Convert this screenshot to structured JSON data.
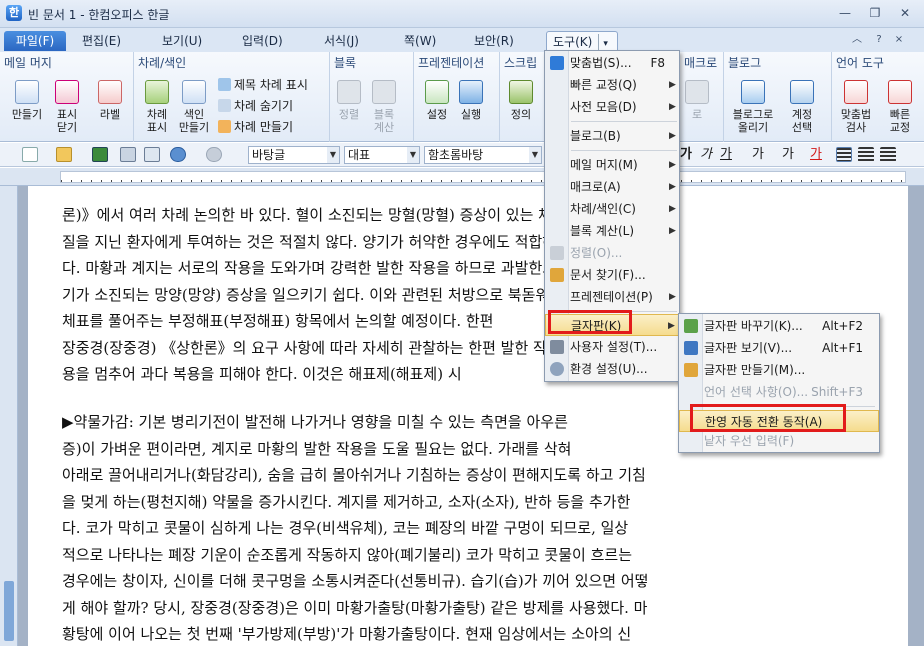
{
  "window": {
    "title": "빈 문서 1 - 한컴오피스 한글",
    "app_icon_letter": "한",
    "min_glyph": "—",
    "restore_glyph": "❐",
    "close_glyph": "✕"
  },
  "menubar": {
    "tabs": [
      "파일(F)",
      "편집(E)",
      "보기(U)",
      "입력(D)",
      "서식(J)",
      "쪽(W)",
      "보안(R)",
      "도구(K)"
    ],
    "active_tab": "도구(K)",
    "active_arrow": "▾",
    "right_controls": [
      "︿",
      "?",
      "×"
    ]
  },
  "ribbon": {
    "groups": {
      "mail_merge": {
        "title": "메일 머지",
        "make": "만들기",
        "show_close": [
          "표시",
          "닫기"
        ]
      },
      "toc": {
        "title": "차례/색인",
        "label": "라벨",
        "toc_show": [
          "차례",
          "표시"
        ],
        "index_make": [
          "색인",
          "만들기"
        ],
        "title_toc_show": "제목 차례 표시",
        "toc_hide": "차례 숨기기",
        "toc_make": "차례 만들기"
      },
      "block": {
        "title": "블록",
        "sort": "정렬",
        "block_calc": [
          "블록",
          "계산"
        ]
      },
      "presentation": {
        "title": "프레젠테이션",
        "settings": "설정",
        "run": "실행"
      },
      "script": {
        "title": "스크립",
        "define": "정의"
      },
      "macro": {
        "title": "매크로",
        "stop": "로"
      },
      "blog": {
        "title": "블로그",
        "upload": [
          "블로그로",
          "올리기"
        ],
        "account": [
          "계정",
          "선택"
        ]
      },
      "language": {
        "title": "언어 도구",
        "spell": [
          "맞춤법",
          "검사"
        ],
        "quick": [
          "빠른",
          "교정"
        ]
      }
    }
  },
  "format_toolbar": {
    "style": "바탕글",
    "lang": "대표",
    "font": "함초롬바탕",
    "text_buttons": [
      "가",
      "가",
      "가",
      "가",
      "가",
      "가"
    ]
  },
  "document": {
    "paragraphs": [
      [
        "론)》에서 여러 차례 논의한 바 있다. 혈이 소진되는 망혈(망혈) 증상이 있는 체",
        "질을 지닌 환자에게 투여하는 것은 적절치 않다. 양기가 허약한 경우에도 적합하지 않",
        "다. 마황과 계지는 서로의 작용을 도와가며 강력한 발한 작용을 하므로 과발한으로 양",
        "기가 소진되는 망양(망양) 증상을 일으키기 쉽다. 이와 관련된 처방으로 북돋워가며",
        "체표를 풀어주는 부정해표(부정해표) 항목에서 논의할 예정이다. 한편",
        "장중경(장중경) 《상한론》의 요구 사항에 따라 자세히 관찰하는 한편 발한 작",
        "용을 멈추어 과다 복용을 피해야 한다. 이것은 해표제(해표제) 시"
      ],
      [
        "▶약물가감: 기본 병리기전이 발전해 나가거나 영향을 미칠 수 있는 측면을 아우른",
        "증)이 가벼운 편이라면, 계지로 마황의 발한 작용을 도울 필요는 없다. 가래를 삭혀",
        "아래로 끌어내리거나(화담강리), 숨을 급히 몰아쉬거나 기침하는 증상이 편해지도록 하고 기침",
        "을 멎게 하는(평천지해) 약물을 증가시킨다. 계지를 제거하고, 소자(소자), 반하 등을 추가한",
        "다. 코가 막히고 콧물이 심하게 나는 경우(비색유체), 코는 폐장의 바깥 구멍이 되므로, 일상",
        "적으로 나타나는 폐장 기운이 순조롭게 작동하지 않아(폐기불리) 코가 막히고 콧물이 흐르는",
        "경우에는 창이자, 신이를 더해 콧구멍을 소통시켜준다(선통비규). 습기(습)가 끼어 있으면 어떻",
        "게 해야 할까? 당시, 장중경(장중경)은 이미 마황가출탕(마황가출탕) 같은 방제를 사용했다. 마",
        "황탕에 이어 나오는 첫 번째 '부가방제(부방)'가 마황가출탕이다. 현재 임상에서는 소아의 신"
      ]
    ]
  },
  "tools_menu": {
    "items": [
      {
        "label": "맞춤법(S)...",
        "shortcut": "F8"
      },
      {
        "label": "빠른 교정(Q)"
      },
      {
        "label": "사전 모음(D)"
      },
      {
        "label": "블로그(B)"
      },
      {
        "label": "메일 머지(M)"
      },
      {
        "label": "매크로(A)"
      },
      {
        "label": "차례/색인(C)"
      },
      {
        "label": "블록 계산(L)"
      },
      {
        "label": "정렬(O)..."
      },
      {
        "label": "문서 찾기(F)..."
      },
      {
        "label": "프레젠테이션(P)"
      },
      {
        "label": "글자판(K)"
      },
      {
        "label": "사용자 설정(T)..."
      },
      {
        "label": "환경 설정(U)..."
      }
    ],
    "submenu_arrow": "▶"
  },
  "keyboard_submenu": {
    "items": [
      {
        "label": "글자판 바꾸기(K)...",
        "shortcut": "Alt+F2"
      },
      {
        "label": "글자판 보기(V)...",
        "shortcut": "Alt+F1"
      },
      {
        "label": "글자판 만들기(M)..."
      },
      {
        "label": "언어 선택 사항(O)...",
        "shortcut": "Shift+F3"
      },
      {
        "label": "한영 자동 전환 동작(A)"
      },
      {
        "label": "낱자 우선 입력(F)"
      }
    ]
  },
  "colors": {
    "highlight": "#f5dc8e",
    "annotation_box": "#e21b1b",
    "file_tab": "#2b67c2"
  }
}
